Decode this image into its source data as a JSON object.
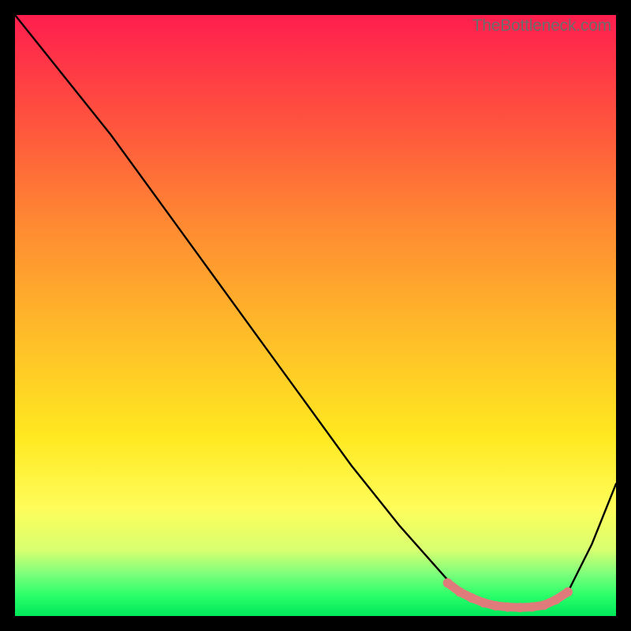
{
  "watermark": "TheBottleneck.com",
  "colors": {
    "gradient_top": "#ff1e4e",
    "gradient_bottom": "#00e85a",
    "curve": "#000000",
    "markers": "#e07b7b",
    "frame_border": "#000000"
  },
  "chart_data": {
    "type": "line",
    "title": "",
    "xlabel": "",
    "ylabel": "",
    "xlim": [
      0,
      100
    ],
    "ylim": [
      0,
      100
    ],
    "series": [
      {
        "name": "bottleneck-curve",
        "x": [
          0,
          8,
          16,
          24,
          32,
          40,
          48,
          56,
          64,
          72,
          76,
          80,
          84,
          88,
          92,
          96,
          100
        ],
        "y": [
          100,
          90,
          80,
          69,
          58,
          47,
          36,
          25,
          15,
          6,
          3,
          1.6,
          1.3,
          1.6,
          4,
          12,
          22
        ]
      }
    ],
    "markers": {
      "name": "optimal-range",
      "x": [
        72,
        74,
        76,
        78,
        80,
        82,
        84,
        86,
        88,
        90,
        92
      ],
      "y": [
        5.5,
        4,
        3,
        2.2,
        1.7,
        1.5,
        1.4,
        1.5,
        1.8,
        2.7,
        4
      ]
    }
  }
}
